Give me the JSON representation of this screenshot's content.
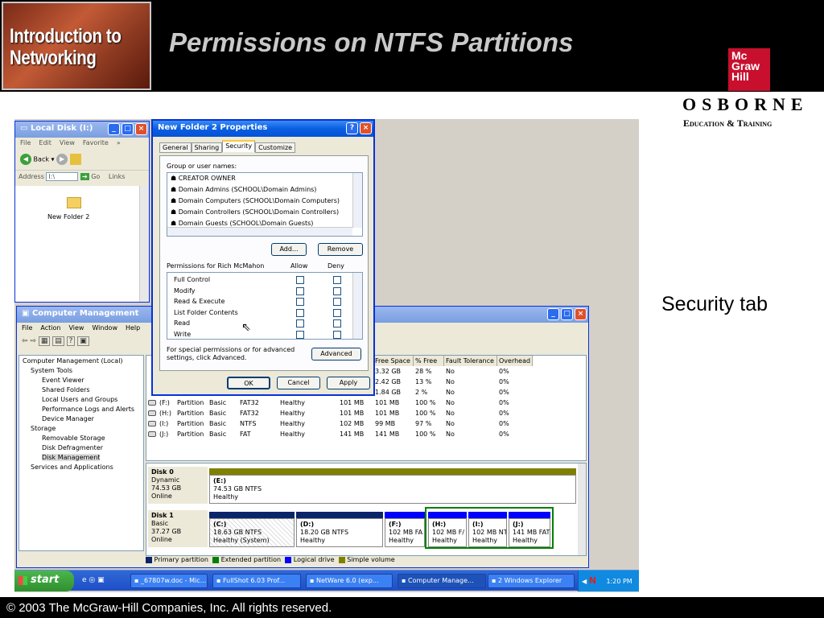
{
  "slide": {
    "logo_text": "Introduction to\nNetworking",
    "title": "Permissions on NTFS Partitions",
    "publisher_logo": "Mc\nGraw\nHill",
    "osborne": "OSBORNE",
    "osborne_sub": "Education & Training",
    "callout": "Security tab",
    "copyright": "© 2003 The McGraw-Hill Companies, Inc. All rights reserved."
  },
  "explorer": {
    "title": "Local Disk (I:)",
    "menu": [
      "File",
      "Edit",
      "View",
      "Favorite",
      "»"
    ],
    "back_label": "Back",
    "address_label": "Address",
    "address_value": "I:\\",
    "go_label": "Go",
    "links_label": "Links",
    "folder_name": "New Folder 2"
  },
  "props": {
    "title": "New Folder 2 Properties",
    "tabs": [
      "General",
      "Sharing",
      "Security",
      "Customize"
    ],
    "group_label": "Group or user names:",
    "users": [
      "CREATOR OWNER",
      "Domain Admins (SCHOOL\\Domain Admins)",
      "Domain Computers (SCHOOL\\Domain Computers)",
      "Domain Controllers (SCHOOL\\Domain Controllers)",
      "Domain Guests (SCHOOL\\Domain Guests)"
    ],
    "add_label": "Add...",
    "remove_label": "Remove",
    "perm_label": "Permissions for Rich McMahon",
    "allow_label": "Allow",
    "deny_label": "Deny",
    "permissions": [
      "Full Control",
      "Modify",
      "Read & Execute",
      "List Folder Contents",
      "Read",
      "Write"
    ],
    "special_text": "For special permissions or for advanced settings, click Advanced.",
    "advanced_label": "Advanced",
    "ok_label": "OK",
    "cancel_label": "Cancel",
    "apply_label": "Apply"
  },
  "compmgmt": {
    "title": "Computer Management",
    "menu": [
      "File",
      "Action",
      "View",
      "Window",
      "Help"
    ],
    "tree": [
      "Computer Management (Local)",
      "System Tools",
      "Event Viewer",
      "Shared Folders",
      "Local Users and Groups",
      "Performance Logs and Alerts",
      "Device Manager",
      "Storage",
      "Removable Storage",
      "Disk Defragmenter",
      "Disk Management",
      "Services and Applications"
    ],
    "columns": [
      "Free Space",
      "% Free",
      "Fault Tolerance",
      "Overhead"
    ],
    "top_rows": [
      [
        "3.32 GB",
        "28 %",
        "No",
        "0%"
      ],
      [
        "2.42 GB",
        "13 %",
        "No",
        "0%"
      ],
      [
        "1.84 GB",
        "2 %",
        "No",
        "0%"
      ]
    ],
    "rows": [
      [
        "(F:)",
        "Partition",
        "Basic",
        "FAT32",
        "Healthy",
        "101 MB",
        "101 MB",
        "100 %",
        "No",
        "0%"
      ],
      [
        "(H:)",
        "Partition",
        "Basic",
        "FAT32",
        "Healthy",
        "101 MB",
        "101 MB",
        "100 %",
        "No",
        "0%"
      ],
      [
        "(I:)",
        "Partition",
        "Basic",
        "NTFS",
        "Healthy",
        "102 MB",
        "99 MB",
        "97 %",
        "No",
        "0%"
      ],
      [
        "(J:)",
        "Partition",
        "Basic",
        "FAT",
        "Healthy",
        "141 MB",
        "141 MB",
        "100 %",
        "No",
        "0%"
      ]
    ],
    "disk0": {
      "name": "Disk 0",
      "type": "Dynamic",
      "size": "74.53 GB",
      "status": "Online",
      "volume": {
        "letter": "(E:)",
        "size": "74.53 GB NTFS",
        "status": "Healthy"
      }
    },
    "disk1": {
      "name": "Disk 1",
      "type": "Basic",
      "size": "37.27 GB",
      "status": "Online",
      "volumes": [
        {
          "letter": "(C:)",
          "size": "18.63 GB NTFS",
          "status": "Healthy (System)"
        },
        {
          "letter": "(D:)",
          "size": "18.20 GB NTFS",
          "status": "Healthy"
        },
        {
          "letter": "(F:)",
          "size": "102 MB FA",
          "status": "Healthy"
        },
        {
          "letter": "(H:)",
          "size": "102 MB F/",
          "status": "Healthy"
        },
        {
          "letter": "(I:)",
          "size": "102 MB NT",
          "status": "Healthy"
        },
        {
          "letter": "(J:)",
          "size": "141 MB FAT",
          "status": "Healthy"
        }
      ]
    },
    "legend": [
      "Primary partition",
      "Extended partition",
      "Logical drive",
      "Simple volume"
    ],
    "colors": {
      "primary": "#0a246a",
      "extended": "#008000",
      "logical": "#0000ff",
      "simple": "#808000"
    }
  },
  "taskbar": {
    "start_label": "start",
    "tasks": [
      "_67807w.doc - Mic...",
      "FullShot 6.03 Prof...",
      "NetWare 6.0 (exp...",
      "Computer Manage...",
      "2 Windows Explorer"
    ],
    "clock": "1:20 PM"
  }
}
